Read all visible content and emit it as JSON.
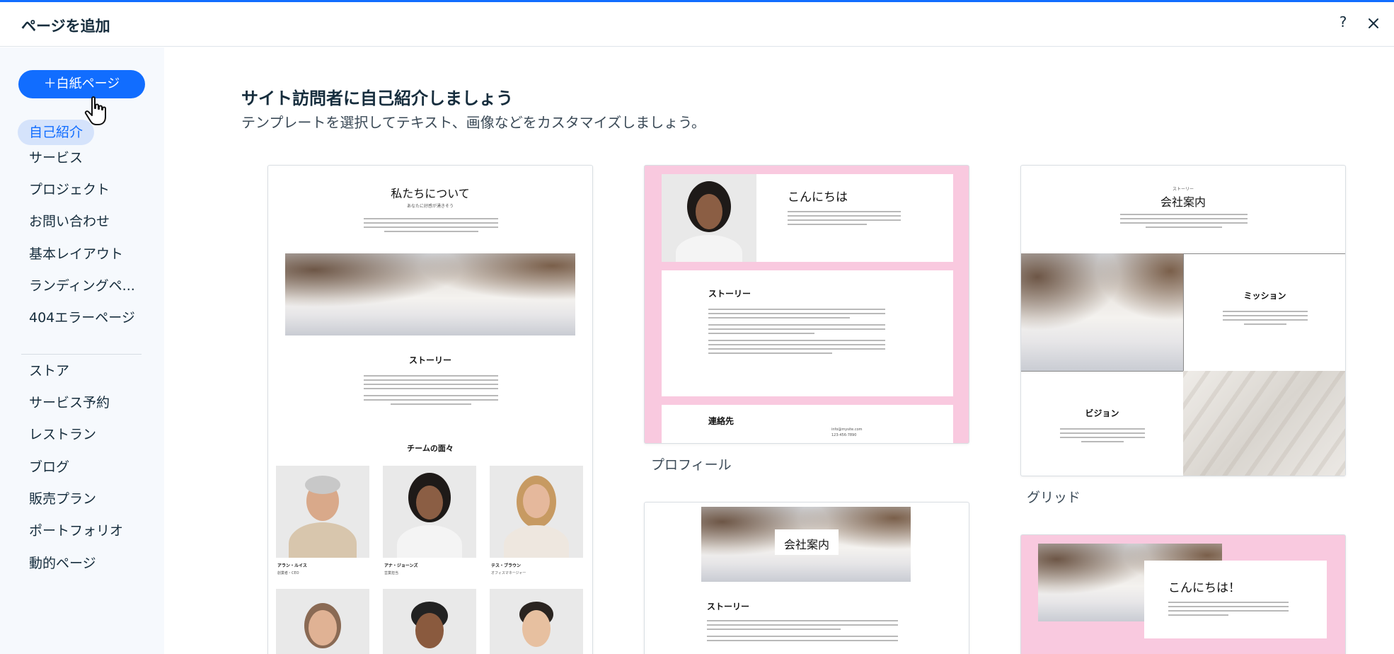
{
  "header": {
    "title": "ページを追加",
    "help_icon": "?",
    "close_icon": "close-icon"
  },
  "colors": {
    "accent": "#116dff",
    "sidebar_bg": "#f6f9fd",
    "active_bg": "#d5e3fb",
    "pink": "#f9c9df"
  },
  "sidebar": {
    "blank_button": "＋白紙ページ",
    "items": [
      {
        "label": "自己紹介",
        "active": true
      },
      {
        "label": "サービス"
      },
      {
        "label": "プロジェクト"
      },
      {
        "label": "お問い合わせ"
      },
      {
        "label": "基本レイアウト"
      },
      {
        "label": "ランディングペ..."
      },
      {
        "label": "404エラーページ"
      }
    ],
    "more_items": [
      {
        "label": "ストア"
      },
      {
        "label": "サービス予約"
      },
      {
        "label": "レストラン"
      },
      {
        "label": "ブログ"
      },
      {
        "label": "販売プラン"
      },
      {
        "label": "ポートフォリオ"
      },
      {
        "label": "動的ページ"
      }
    ]
  },
  "main": {
    "title": "サイト訪問者に自己紹介しましょう",
    "subtitle": "テンプレートを選択してテキスト、画像などをカスタマイズしましょう。"
  },
  "templates": {
    "about": {
      "heading": "私たちについて",
      "tagline": "あなたに好感が湧きそう",
      "story": "ストーリー",
      "team": "チームの面々",
      "members": [
        {
          "name": "アラン・ルイス",
          "role": "創業者・CEO"
        },
        {
          "name": "アナ・ジョーンズ",
          "role": "営業担当"
        },
        {
          "name": "テス・ブラウン",
          "role": "オフィスマネージャー"
        }
      ]
    },
    "profile": {
      "greeting": "こんにちは",
      "story": "ストーリー",
      "contact": "連絡先",
      "email": "info@mysite.com",
      "phone": "123-456-7890",
      "label": "プロフィール"
    },
    "grid": {
      "small": "ストーリー",
      "heading": "会社案内",
      "mission": "ミッション",
      "vision": "ビジョン",
      "label": "グリッド"
    },
    "company": {
      "banner": "会社案内",
      "story": "ストーリー"
    },
    "hello": {
      "greeting": "こんにちは！"
    }
  }
}
